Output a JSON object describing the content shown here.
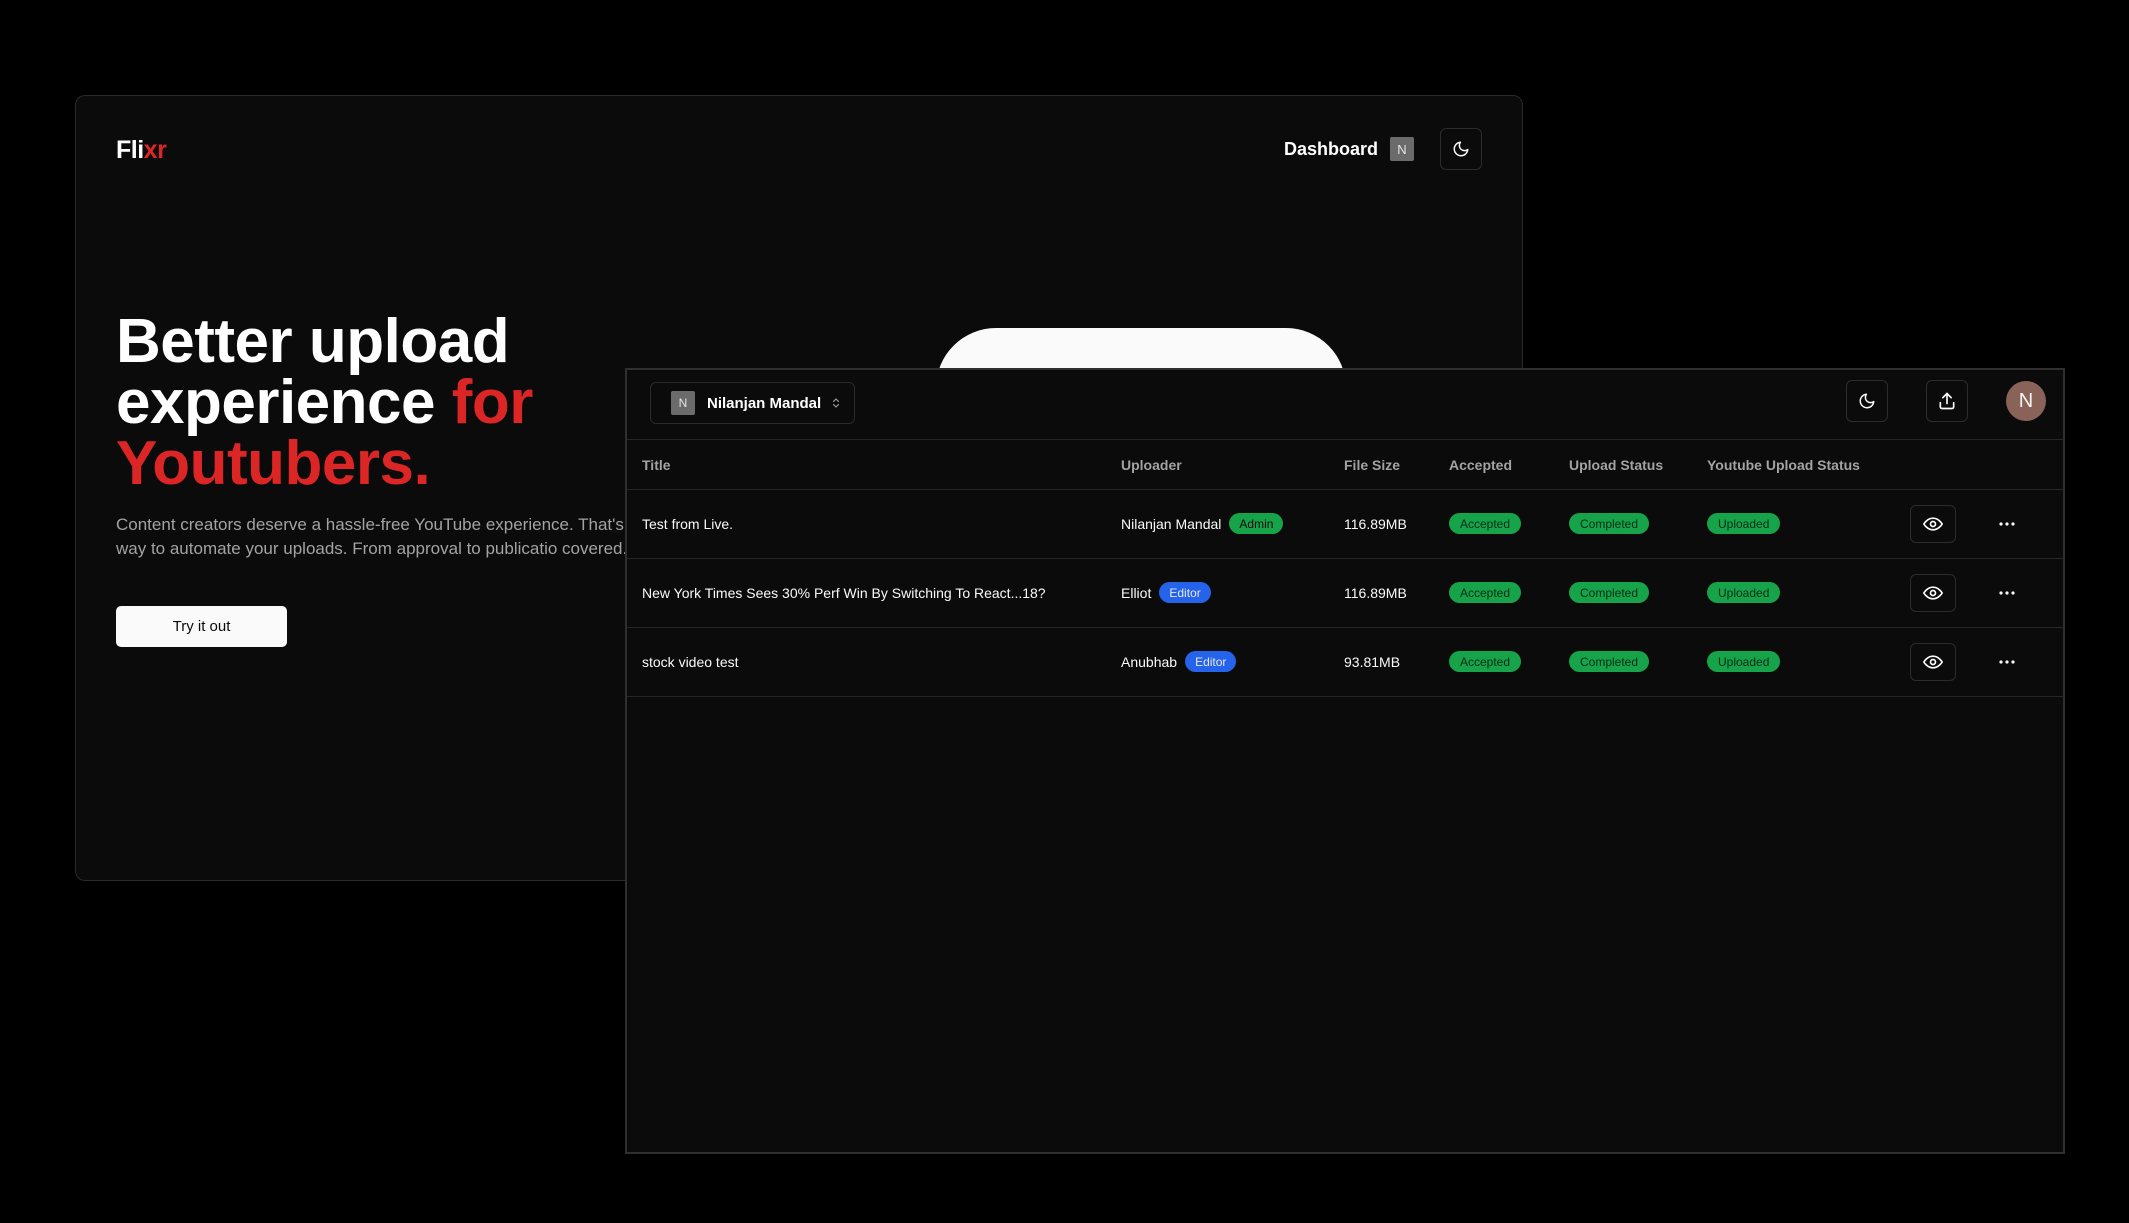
{
  "landing": {
    "logo_main": "Fli",
    "logo_accent": "xr",
    "nav": {
      "dashboard_label": "Dashboard",
      "avatar_initial": "N",
      "theme_icon": "moon-icon"
    },
    "hero": {
      "line1": "Better upload",
      "line2_white": "experience ",
      "line2_red": "for",
      "line3_red": "Youtubers.",
      "description": "Content creators deserve a hassle-free YouTube experience. That's smarter way to automate your uploads. From approval to publicatio covered.",
      "cta_label": "Try it out"
    },
    "colors": {
      "accent": "#dc2626",
      "background": "#0b0b0b"
    }
  },
  "dashboard": {
    "team": {
      "initial": "N",
      "name": "Nilanjan Mandal",
      "icon": "chevrons-up-down-icon"
    },
    "actions": {
      "theme_icon": "moon-icon",
      "upload_icon": "upload-icon",
      "avatar_initial": "N"
    },
    "columns": [
      "Title",
      "Uploader",
      "File Size",
      "Accepted",
      "Upload Status",
      "Youtube Upload Status"
    ],
    "rows": [
      {
        "title": "Test from Live.",
        "uploader": "Nilanjan Mandal",
        "role": "Admin",
        "size": "116.89MB",
        "accepted": "Accepted",
        "upload_status": "Completed",
        "youtube_status": "Uploaded"
      },
      {
        "title": "New York Times Sees 30% Perf Win By Switching To React...18?",
        "uploader": "Elliot",
        "role": "Editor",
        "size": "116.89MB",
        "accepted": "Accepted",
        "upload_status": "Completed",
        "youtube_status": "Uploaded"
      },
      {
        "title": "stock video test",
        "uploader": "Anubhab",
        "role": "Editor",
        "size": "93.81MB",
        "accepted": "Accepted",
        "upload_status": "Completed",
        "youtube_status": "Uploaded"
      }
    ],
    "colors": {
      "success": "#16a34a",
      "editor": "#2563eb",
      "avatar": "#8a6358"
    }
  }
}
